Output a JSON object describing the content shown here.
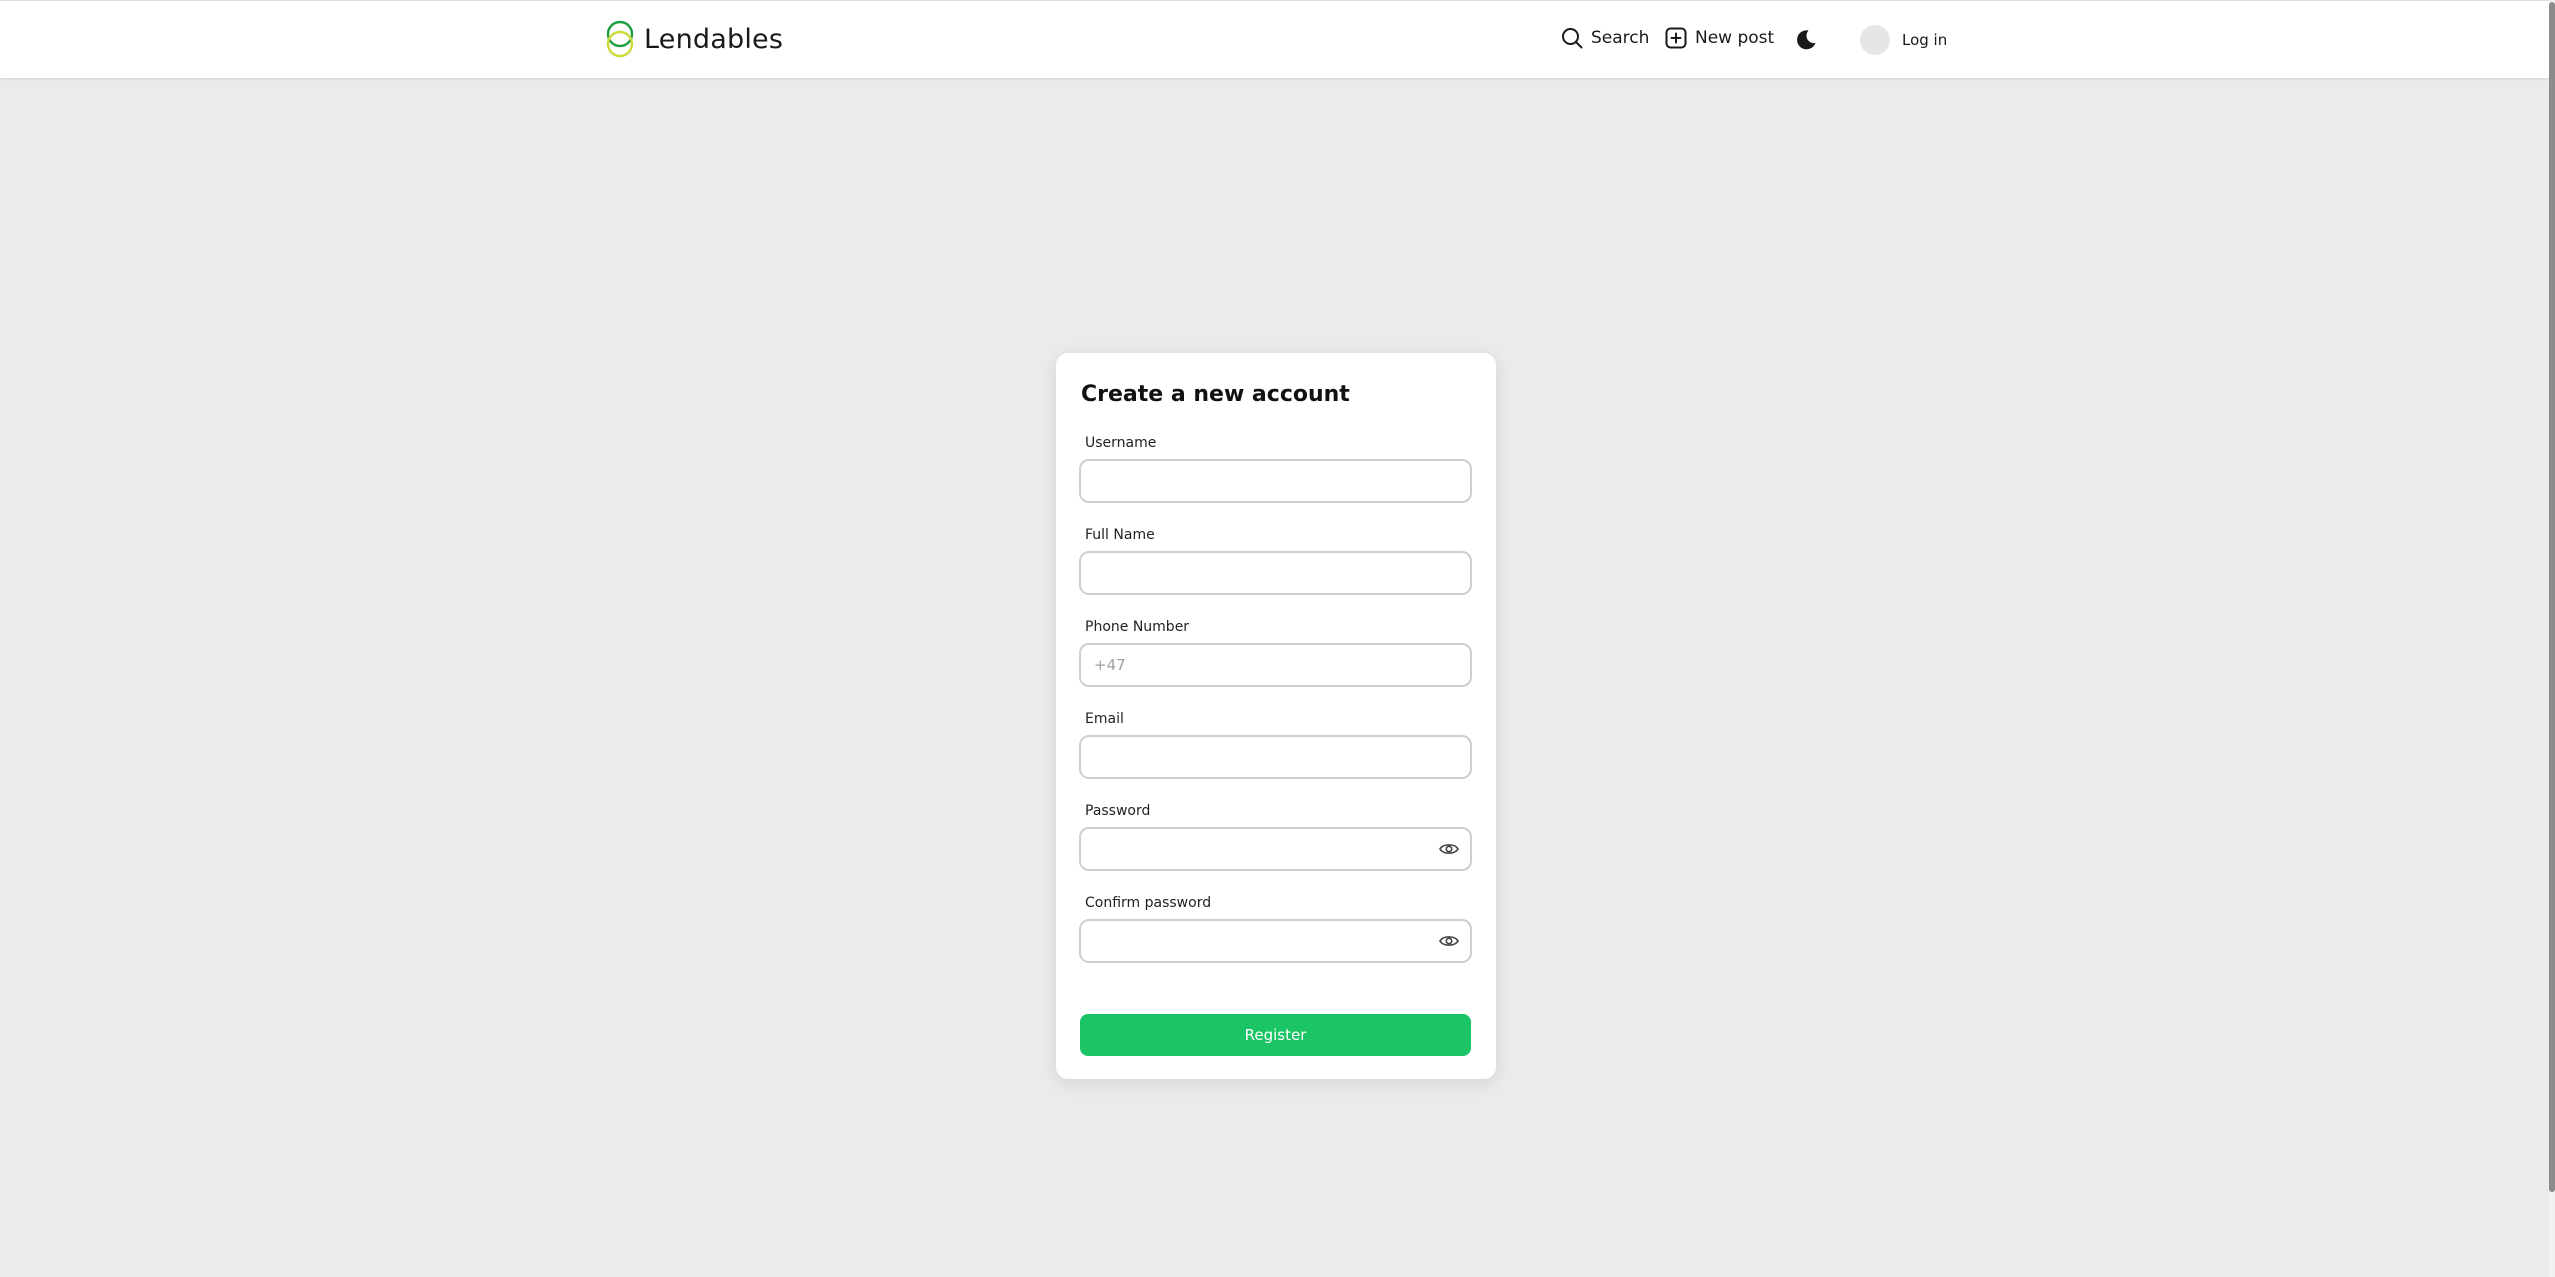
{
  "header": {
    "brand_name": "Lendables",
    "logo_icon": "two-rings-logo",
    "search_label": "Search",
    "new_post_label": "New post",
    "theme_icon": "moon-icon",
    "login_label": "Log in"
  },
  "form": {
    "title": "Create a new account",
    "fields": [
      {
        "label": "Username",
        "placeholder": "",
        "value": ""
      },
      {
        "label": "Full Name",
        "placeholder": "",
        "value": ""
      },
      {
        "label": "Phone Number",
        "placeholder": "+47",
        "value": ""
      },
      {
        "label": "Email",
        "placeholder": "",
        "value": ""
      },
      {
        "label": "Password",
        "placeholder": "",
        "value": "",
        "icon": "eye-icon"
      },
      {
        "label": "Confirm password",
        "placeholder": "",
        "value": "",
        "icon": "eye-icon"
      }
    ],
    "submit_label": "Register"
  },
  "colors": {
    "background": "#ebebeb",
    "accent": "#1bc565",
    "logo_green": "#1f9e3f",
    "logo_yellow": "#cddc39"
  }
}
